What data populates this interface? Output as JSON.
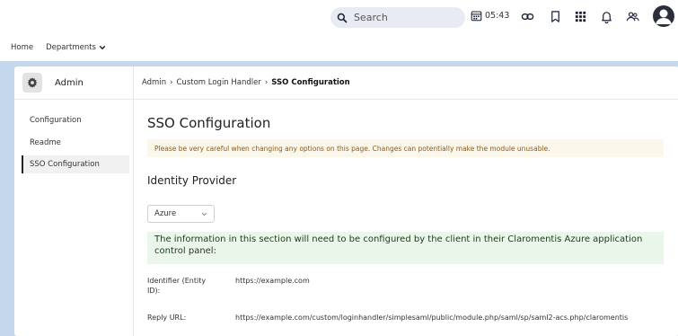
{
  "topbar": {
    "search_placeholder": "Search",
    "time": "05:43",
    "icons": [
      "calendar-icon",
      "link-icon",
      "bookmark-icon",
      "apps-grid-icon",
      "bell-icon",
      "people-icon",
      "user-avatar-icon"
    ]
  },
  "nav": {
    "home": "Home",
    "departments": "Departments"
  },
  "sidebar": {
    "title": "Admin",
    "items": [
      {
        "label": "Configuration"
      },
      {
        "label": "Readme"
      },
      {
        "label": "SSO Configuration"
      }
    ]
  },
  "breadcrumb": {
    "item1": "Admin",
    "sep1": "›",
    "item2": "Custom Login Handler",
    "sep2": "›",
    "current": "SSO Configuration"
  },
  "main": {
    "title": "SSO Configuration",
    "warning": "Please be very careful when changing any options on this page. Changes can potentially make the module unusable.",
    "section_title": "Identity Provider",
    "provider_select": "Azure",
    "info_text": "The information in this section will need to be configured by the client in their Claromentis Azure application control panel:",
    "fields": [
      {
        "label": "Identifier (Entity ID):",
        "value": "https://example.com"
      },
      {
        "label": "Reply URL:",
        "value": "https://example.com/custom/loginhandler/simplesaml/public/module.php/saml/sp/saml2-acs.php/claromentis"
      }
    ]
  },
  "colors": {
    "frame_bg": "#c4d7ec",
    "warning_bg": "#fbf7ea",
    "warning_text": "#8a5a1b",
    "info_bg": "#eaf6ea",
    "search_bg": "#e8ebf3"
  }
}
